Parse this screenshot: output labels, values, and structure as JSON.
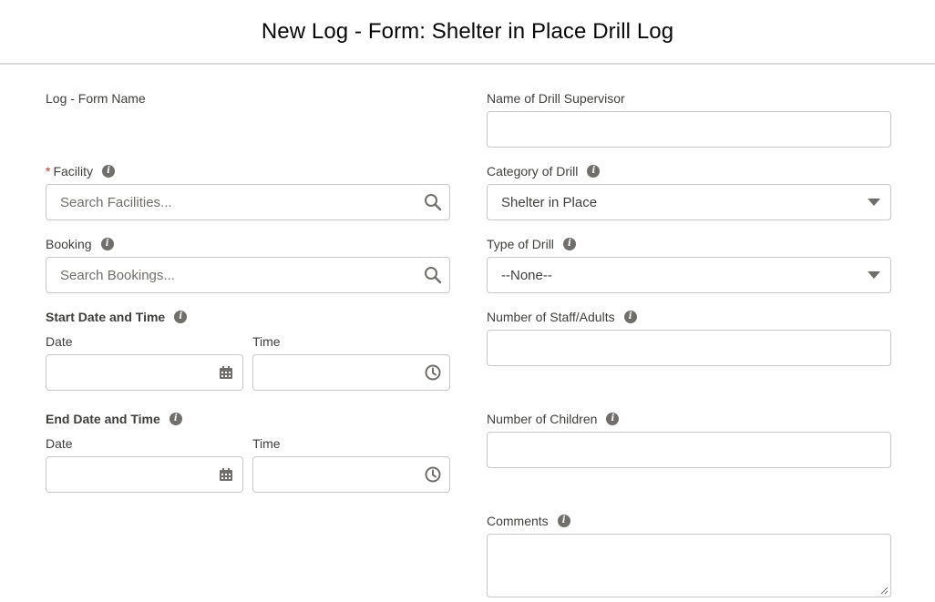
{
  "header": {
    "title": "New Log - Form: Shelter in Place Drill Log"
  },
  "left": {
    "form_name_label": "Log - Form Name",
    "facility": {
      "required_marker": "*",
      "label": "Facility",
      "placeholder": "Search Facilities..."
    },
    "booking": {
      "label": "Booking",
      "placeholder": "Search Bookings..."
    },
    "start": {
      "label": "Start Date and Time",
      "date_label": "Date",
      "time_label": "Time"
    },
    "end": {
      "label": "End Date and Time",
      "date_label": "Date",
      "time_label": "Time"
    }
  },
  "right": {
    "supervisor": {
      "label": "Name of Drill Supervisor",
      "value": ""
    },
    "category": {
      "label": "Category of Drill",
      "selected": "Shelter in Place"
    },
    "type": {
      "label": "Type of Drill",
      "selected": "--None--"
    },
    "staff": {
      "label": "Number of Staff/Adults",
      "value": ""
    },
    "children": {
      "label": "Number of Children",
      "value": ""
    },
    "comments": {
      "label": "Comments",
      "value": ""
    }
  },
  "icons": {
    "info": "info-icon",
    "search": "search-icon",
    "dropdown": "caret-down-icon",
    "calendar": "calendar-icon",
    "clock": "clock-icon"
  },
  "colors": {
    "required": "#c23934",
    "border": "#c9c7c5",
    "icon": "#706e6b"
  }
}
